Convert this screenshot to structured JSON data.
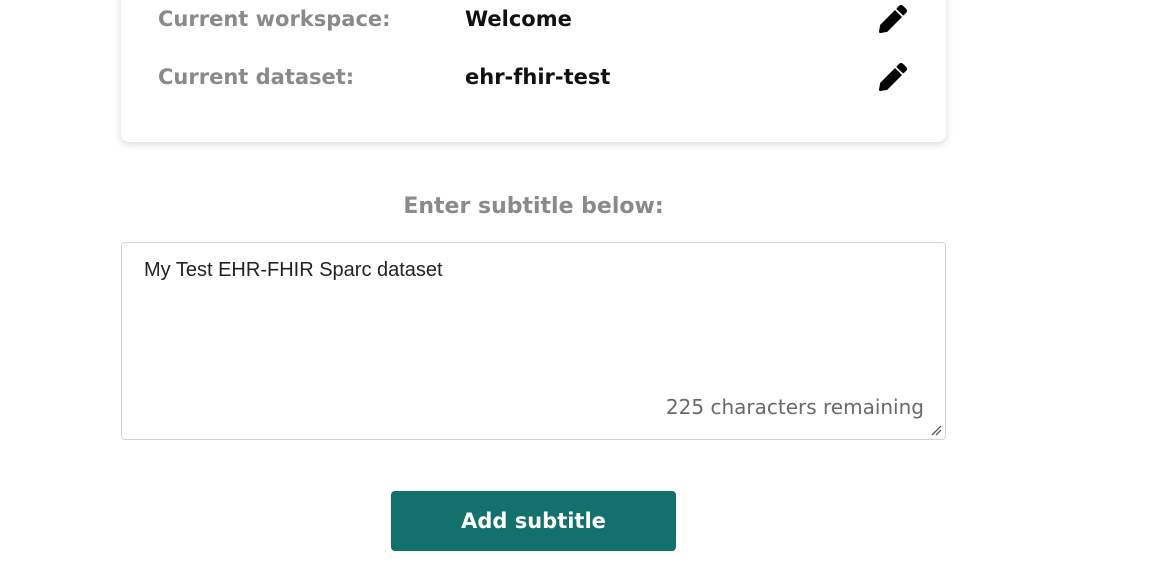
{
  "workspace": {
    "label": "Current workspace:",
    "value": "Welcome",
    "edit_icon": "pencil-icon"
  },
  "dataset": {
    "label": "Current dataset:",
    "value": "ehr-fhir-test",
    "edit_icon": "pencil-icon"
  },
  "subtitle": {
    "heading": "Enter subtitle below:",
    "value": "My Test EHR-FHIR Sparc dataset",
    "chars_remaining": "225 characters remaining"
  },
  "actions": {
    "add_label": "Add subtitle"
  },
  "colors": {
    "accent": "#13716d",
    "label": "#8a8a8a",
    "value": "#111111"
  }
}
